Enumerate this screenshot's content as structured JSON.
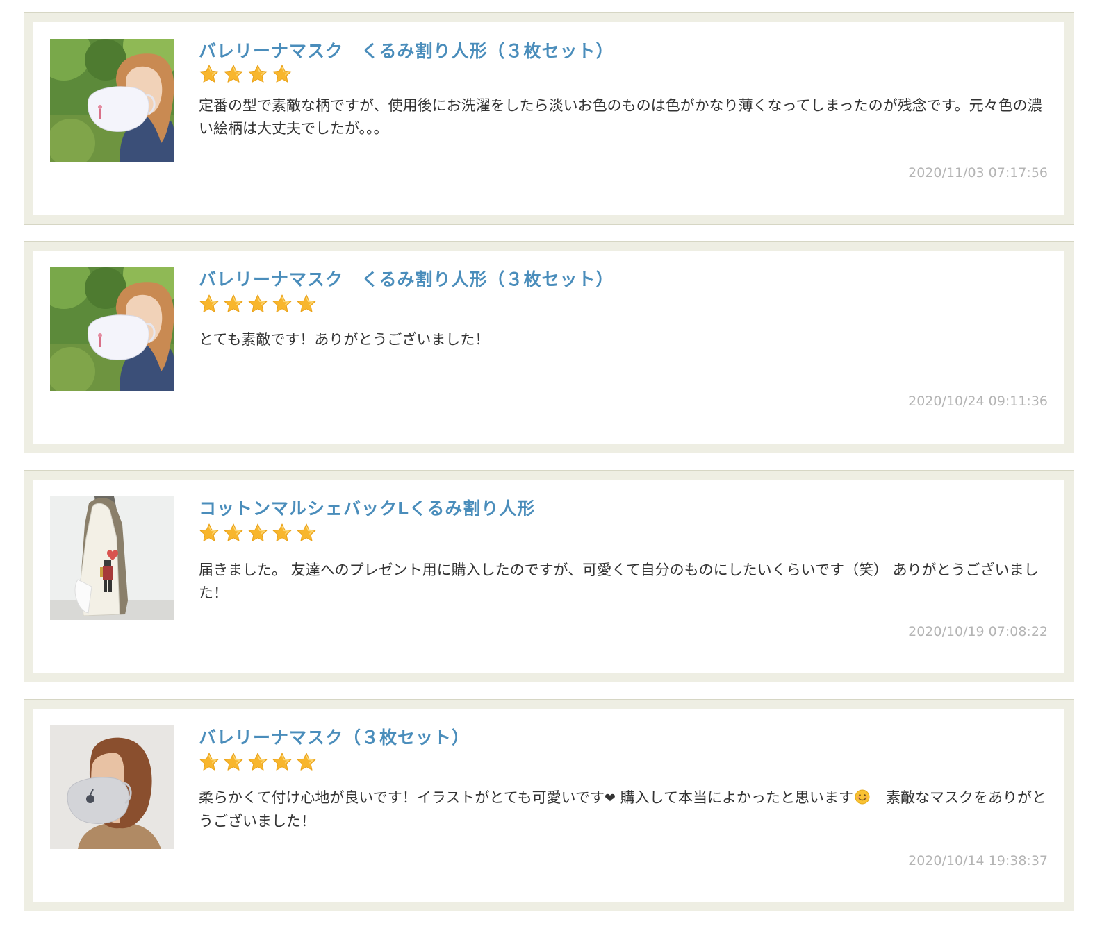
{
  "reviews": [
    {
      "title": "バレリーナマスク　くるみ割り人形（３枚セット）",
      "rating": 4,
      "text": "定番の型で素敵な柄ですが、使用後にお洗濯をしたら淡いお色のものは色がかなり薄くなってしまったのが残念です。元々色の濃い絵柄は大丈夫でしたが。。。",
      "timestamp": "2020/11/03 07:17:56",
      "thumbnail": "mask-woman-park"
    },
    {
      "title": "バレリーナマスク　くるみ割り人形（３枚セット）",
      "rating": 5,
      "text": "とても素敵です！ありがとうございました！",
      "timestamp": "2020/10/24 09:11:36",
      "thumbnail": "mask-woman-park"
    },
    {
      "title": "コットンマルシェバックLくるみ割り人形",
      "rating": 5,
      "text": "届きました。 友達へのプレゼント用に購入したのですが、可愛くて自分のものにしたいくらいです（笑） ありがとうございました！",
      "timestamp": "2020/10/19 07:08:22",
      "thumbnail": "tote-bag"
    },
    {
      "title": "バレリーナマスク（３枚セット）",
      "rating": 5,
      "text_parts": {
        "before_heart": "柔らかくて付け心地が良いです！イラストがとても可愛いです",
        "heart": "❤",
        "middle": " 購入して本当によかったと思います",
        "after_smile": "　素敵なマスクをありがとうございました！"
      },
      "timestamp": "2020/10/14 19:38:37",
      "thumbnail": "mask-woman-indoor"
    }
  ],
  "colors": {
    "title_link": "#4a8dbb",
    "star": "#f7b32b",
    "card_border": "#eeeee3",
    "timestamp": "#b4b4b4"
  }
}
